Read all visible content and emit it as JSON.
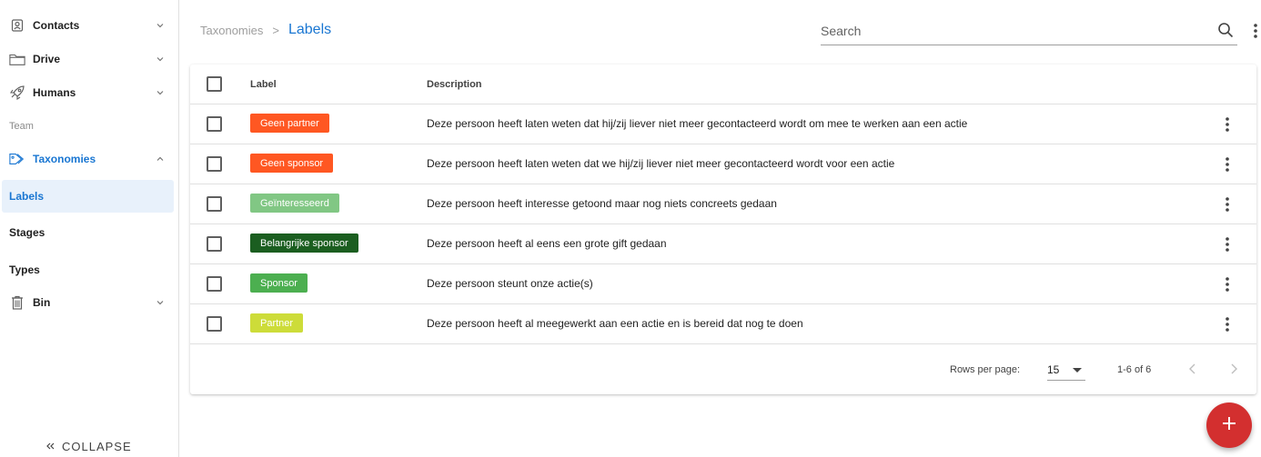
{
  "sidebar": {
    "items": [
      {
        "label": "Contacts",
        "icon": "contacts-icon"
      },
      {
        "label": "Drive",
        "icon": "folder-icon"
      },
      {
        "label": "Humans",
        "icon": "rocket-icon"
      },
      {
        "label": "Taxonomies",
        "icon": "tag-icon"
      },
      {
        "label": "Bin",
        "icon": "trash-icon"
      }
    ],
    "section_team": "Team",
    "sub_items": [
      "Labels",
      "Stages",
      "Types"
    ],
    "collapse_label": "COLLAPSE",
    "accent_color": "#1976d2"
  },
  "header": {
    "breadcrumb_root": "Taxonomies",
    "breadcrumb_sep": ">",
    "breadcrumb_current": "Labels",
    "search_placeholder": "Search"
  },
  "table": {
    "columns": [
      "Label",
      "Description"
    ],
    "rows": [
      {
        "label": "Geen partner",
        "color": "#ff5722",
        "description": "Deze persoon heeft laten weten dat hij/zij liever niet meer gecontacteerd wordt om mee te werken aan een actie"
      },
      {
        "label": "Geen sponsor",
        "color": "#ff5722",
        "description": "Deze persoon heeft laten weten dat we hij/zij liever niet meer gecontacteerd wordt voor een actie"
      },
      {
        "label": "Geïnteresseerd",
        "color": "#81c784",
        "description": "Deze persoon heeft interesse getoond maar nog niets concreets gedaan"
      },
      {
        "label": "Belangrijke sponsor",
        "color": "#1b5e20",
        "description": "Deze persoon heeft al eens een grote gift gedaan"
      },
      {
        "label": "Sponsor",
        "color": "#4caf50",
        "description": "Deze persoon steunt onze actie(s)"
      },
      {
        "label": "Partner",
        "color": "#cddc39",
        "description": "Deze persoon heeft al meegewerkt aan een actie en is bereid dat nog te doen"
      }
    ],
    "footer": {
      "rows_per_page_label": "Rows per page:",
      "rows_per_page_value": "15",
      "range": "1-6 of 6"
    }
  },
  "fab": {
    "icon": "plus-icon",
    "color": "#d32f2f"
  }
}
